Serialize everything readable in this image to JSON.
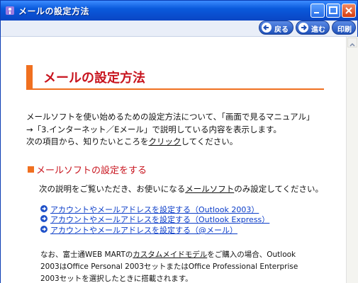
{
  "window": {
    "title": "メールの設定方法"
  },
  "toolbar": {
    "back_label": "戻る",
    "forward_label": "進む",
    "print_label": "印刷"
  },
  "page": {
    "title": "メールの設定方法",
    "intro_line1": "メールソフトを使い始めるための設定方法について、「画面で見るマニュアル」",
    "intro_line2": "→「3.インターネット／Eメール」で説明している内容を表示します。",
    "intro_line3_before": "次の項目から、知りたいところを",
    "intro_line3_link": "クリック",
    "intro_line3_after": "してください。"
  },
  "section": {
    "title": "メールソフトの設定をする",
    "desc_before": "次の説明をご覧いただき、お使いになる",
    "desc_link": "メールソフト",
    "desc_after": "のみ設定してください。",
    "links": [
      "アカウントやメールアドレスを設定する（Outlook 2003）",
      "アカウントやメールアドレスを設定する（Outlook Express）",
      "アカウントやメールアドレスを設定する（@メール）"
    ],
    "note_line1_before": "なお、富士通WEB MARTの",
    "note_line1_link": "カスタムメイドモデル",
    "note_line1_after": "をご購入の場合、Outlook",
    "note_line2": "2003はOffice Personal 2003セットまたはOffice Professional Enterprise",
    "note_line3": "2003セットを選択したときに搭載されます。"
  },
  "colors": {
    "titlebar": "#0a5adc",
    "accent_orange": "#f07020",
    "heading_red": "#c8141e",
    "link_blue": "#0a3cc8"
  },
  "icons": {
    "app": "help-book-icon",
    "back": "arrow-left-icon",
    "forward": "arrow-right-icon",
    "link_bullet": "circle-arrow-right-icon"
  }
}
